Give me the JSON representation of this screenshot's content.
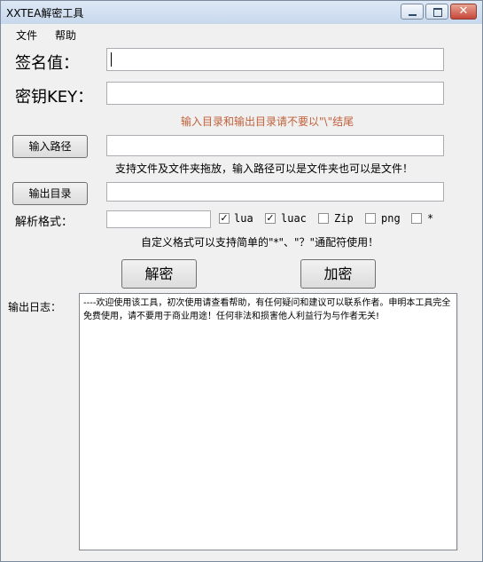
{
  "window": {
    "title": "XXTEA解密工具"
  },
  "menu": {
    "file": "文件",
    "help": "帮助"
  },
  "form": {
    "sign_label": "签名值：",
    "key_label": "密钥KEY：",
    "path_warning": "输入目录和输出目录请不要以\"\\\"结尾",
    "input_button": "输入路径",
    "input_hint": "支持文件及文件夹拖放，输入路径可以是文件夹也可以是文件！",
    "output_button": "输出目录",
    "format_label": "解析格式：",
    "formats": [
      {
        "label": "lua",
        "checked": true
      },
      {
        "label": "luac",
        "checked": true
      },
      {
        "label": "Zip",
        "checked": false
      },
      {
        "label": "png",
        "checked": false
      },
      {
        "label": "*",
        "checked": false
      }
    ],
    "format_hint": "自定义格式可以支持简单的\"*\"、\"？\"通配符使用！",
    "decrypt_button": "解密",
    "encrypt_button": "加密",
    "log_label": "输出日志：",
    "log_text": "----欢迎使用该工具，初次使用请查看帮助，有任何疑问和建议可以联系作者。申明本工具完全免费使用，请不要用于商业用途！任何非法和损害他人利益行为与作者无关!"
  },
  "colors": {
    "warning": "#c0603a",
    "window_bg": "#f0f0f0"
  }
}
